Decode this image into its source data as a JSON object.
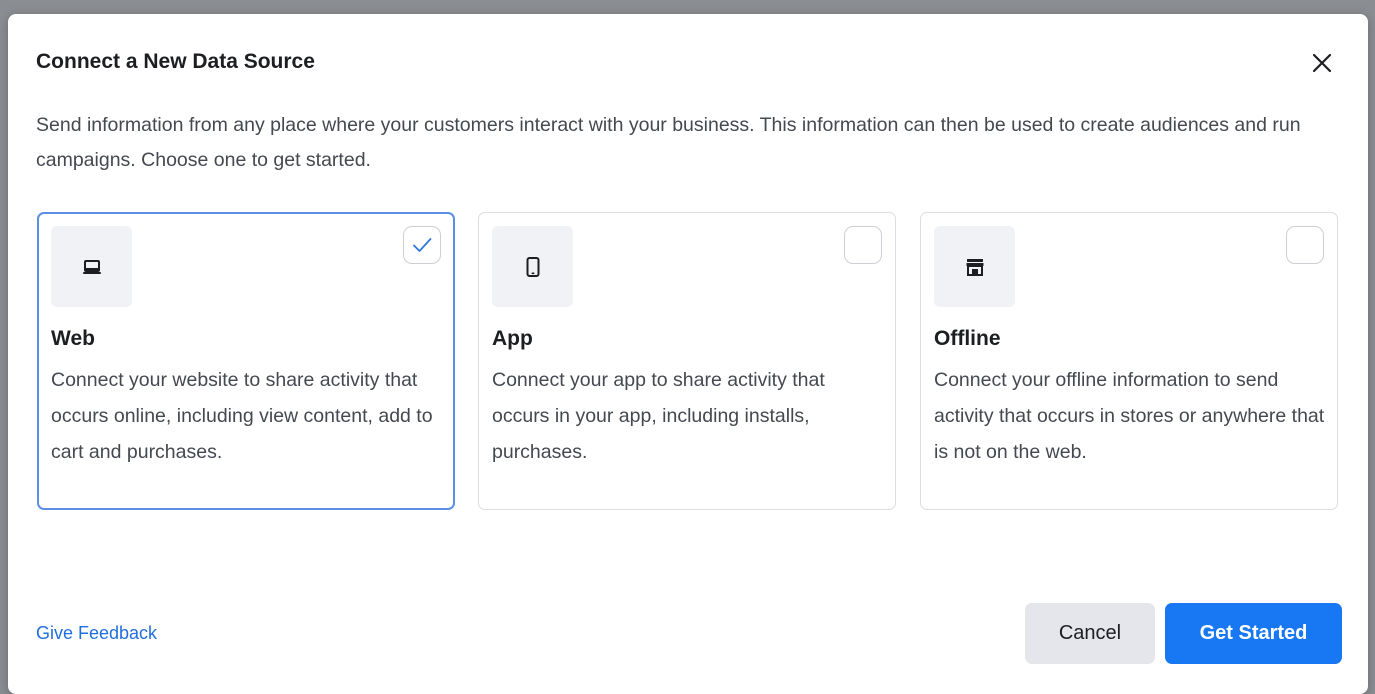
{
  "dialog": {
    "title": "Connect a New Data Source",
    "description": "Send information from any place where your customers interact with your business. This information can then be used to create audiences and run campaigns. Choose one to get started."
  },
  "options": [
    {
      "title": "Web",
      "description": "Connect your website to share activity that occurs online, including view content, add to cart and purchases.",
      "icon": "laptop-icon",
      "selected": true
    },
    {
      "title": "App",
      "description": "Connect your app to share activity that occurs in your app, including installs, purchases.",
      "icon": "mobile-phone-icon",
      "selected": false
    },
    {
      "title": "Offline",
      "description": "Connect your offline information to send activity that occurs in stores or anywhere that is not on the web.",
      "icon": "store-icon",
      "selected": false
    }
  ],
  "footer": {
    "feedback_label": "Give Feedback",
    "cancel_label": "Cancel",
    "primary_label": "Get Started"
  },
  "colors": {
    "accent": "#1877f2",
    "link": "#216fdb",
    "selected_border": "#5b8fe6",
    "icon_tile": "#f0f2f5"
  }
}
